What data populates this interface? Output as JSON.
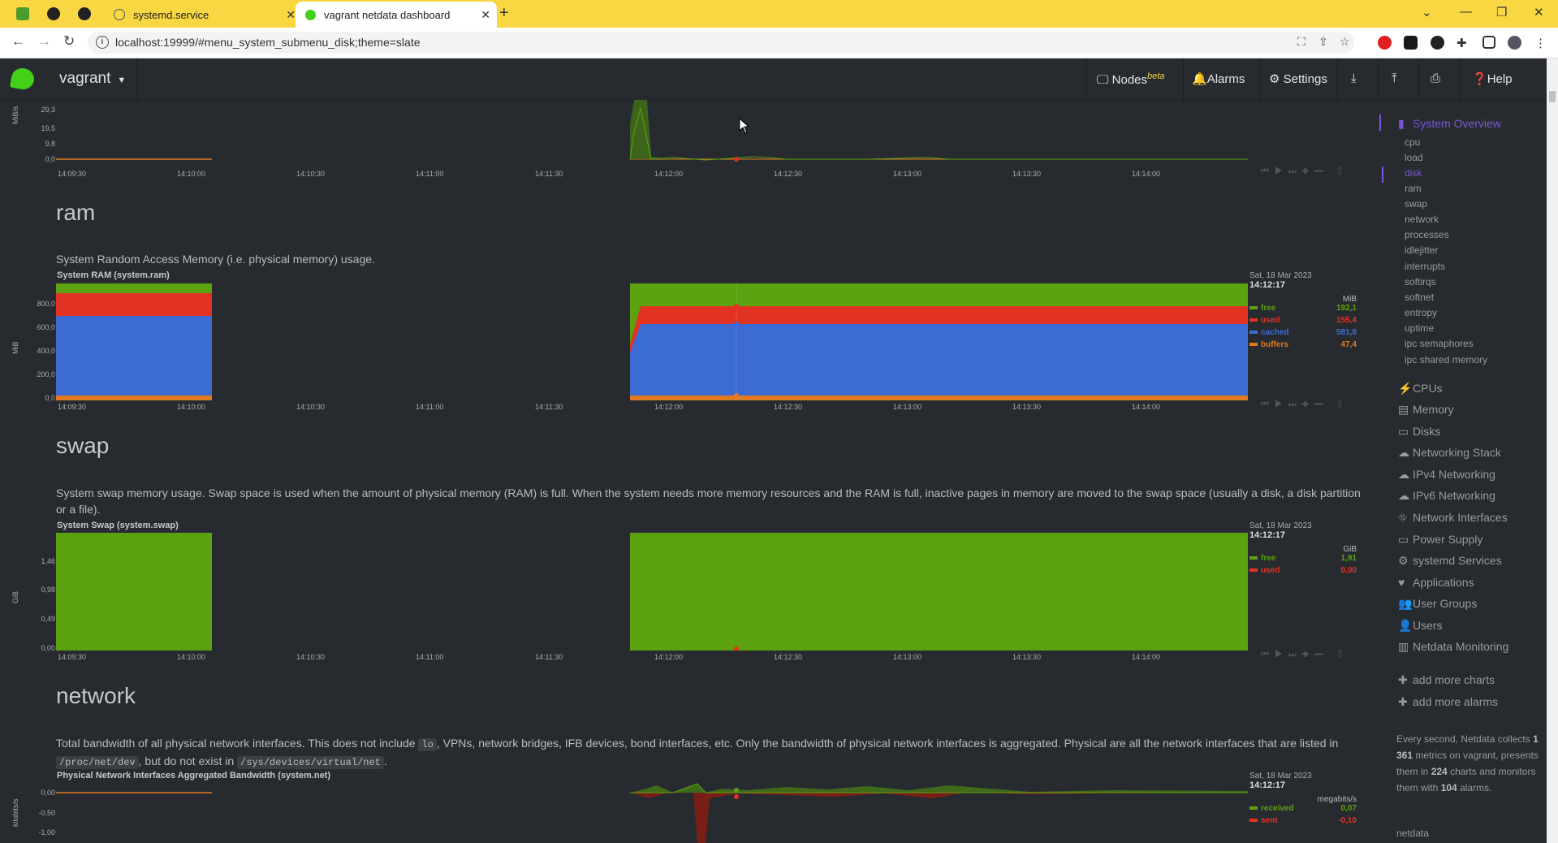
{
  "browser": {
    "tabs": [
      {
        "title": "systemd.service"
      },
      {
        "title": "vagrant netdata dashboard"
      }
    ],
    "url": "localhost:19999/#menu_system_submenu_disk;theme=slate"
  },
  "header": {
    "hostname": "vagrant",
    "nodes_label": "Nodes",
    "nodes_badge": "beta",
    "alarms_label": "Alarms",
    "settings_label": "Settings",
    "help_label": "Help"
  },
  "time_axis": [
    "14:09:30",
    "14:10:00",
    "14:10:30",
    "14:11:00",
    "14:11:30",
    "14:12:00",
    "14:12:30",
    "14:13:00",
    "14:13:30",
    "14:14:00"
  ],
  "disk_chart": {
    "unit": "MiB/s",
    "y_ticks": [
      "29,3",
      "19,5",
      "9,8",
      "0,0"
    ]
  },
  "ram": {
    "title": "ram",
    "description": "System Random Access Memory (i.e. physical memory) usage.",
    "chart_title": "System RAM (system.ram)",
    "unit": "MiB",
    "y_ticks": [
      "800,0",
      "600,0",
      "400,0",
      "200,0",
      "0,0"
    ],
    "legend": {
      "date": "Sat, 18 Mar 2023",
      "time": "14:12:17",
      "unit": "MiB",
      "rows": [
        {
          "name": "free",
          "value": "192,1",
          "color": "#5ba110"
        },
        {
          "name": "used",
          "value": "155,4",
          "color": "#e23322"
        },
        {
          "name": "cached",
          "value": "581,8",
          "color": "#3c6bd4"
        },
        {
          "name": "buffers",
          "value": "47,4",
          "color": "#e07a1f"
        }
      ]
    }
  },
  "swap": {
    "title": "swap",
    "description": "System swap memory usage. Swap space is used when the amount of physical memory (RAM) is full. When the system needs more memory resources and the RAM is full, inactive pages in memory are moved to the swap space (usually a disk, a disk partition or a file).",
    "chart_title": "System Swap (system.swap)",
    "unit": "GiB",
    "y_ticks": [
      "1,46",
      "0,98",
      "0,49",
      "0,00"
    ],
    "legend": {
      "date": "Sat, 18 Mar 2023",
      "time": "14:12:17",
      "unit": "GiB",
      "rows": [
        {
          "name": "free",
          "value": "1,91",
          "color": "#5ba110"
        },
        {
          "name": "used",
          "value": "0,00",
          "color": "#e23322"
        }
      ]
    }
  },
  "network": {
    "title": "network",
    "desc_part1": "Total bandwidth of all physical network interfaces. This does not include",
    "code1": "lo",
    "desc_part2": ", VPNs, network bridges, IFB devices, bond interfaces, etc. Only the bandwidth of physical network interfaces is aggregated. Physical are all the network interfaces that are listed in",
    "code2": "/proc/net/dev",
    "desc_part3": ", but do not exist in",
    "code3": "/sys/devices/virtual/net",
    "desc_part4": ".",
    "chart_title": "Physical Network Interfaces Aggregated Bandwidth (system.net)",
    "unit": "kilobits/s",
    "y_ticks": [
      "0,00",
      "-0,50",
      "-1,00"
    ],
    "legend": {
      "date": "Sat, 18 Mar 2023",
      "time": "14:12:17",
      "unit": "megabits/s",
      "rows": [
        {
          "name": "received",
          "value": "0,07",
          "color": "#5ba110"
        },
        {
          "name": "sent",
          "value": "-0,10",
          "color": "#e23322"
        }
      ]
    }
  },
  "sidebar": {
    "overview": "System Overview",
    "sub_items": [
      "cpu",
      "load",
      "disk",
      "ram",
      "swap",
      "network",
      "processes",
      "idlejitter",
      "interrupts",
      "softirqs",
      "softnet",
      "entropy",
      "uptime",
      "ipc semaphores",
      "ipc shared memory"
    ],
    "sections": [
      {
        "label": "CPUs",
        "icon": "bolt-icon"
      },
      {
        "label": "Memory",
        "icon": "memory-icon"
      },
      {
        "label": "Disks",
        "icon": "disk-icon"
      },
      {
        "label": "Networking Stack",
        "icon": "cloud-icon"
      },
      {
        "label": "IPv4 Networking",
        "icon": "cloud-icon"
      },
      {
        "label": "IPv6 Networking",
        "icon": "cloud-icon"
      },
      {
        "label": "Network Interfaces",
        "icon": "network-icon"
      },
      {
        "label": "Power Supply",
        "icon": "battery-icon"
      },
      {
        "label": "systemd Services",
        "icon": "gears-icon"
      },
      {
        "label": "Applications",
        "icon": "heartbeat-icon"
      },
      {
        "label": "User Groups",
        "icon": "users-icon"
      },
      {
        "label": "Users",
        "icon": "user-icon"
      },
      {
        "label": "Netdata Monitoring",
        "icon": "chart-icon"
      }
    ],
    "add_charts": "add more charts",
    "add_alarms": "add more alarms",
    "note_1": "Every second, Netdata collects",
    "metrics": "1 361",
    "note_2": "metrics on vagrant, presents them in",
    "charts": "224",
    "note_3": "charts and monitors them with",
    "alarms": "104",
    "note_4": "alarms.",
    "footer": "netdata"
  }
}
